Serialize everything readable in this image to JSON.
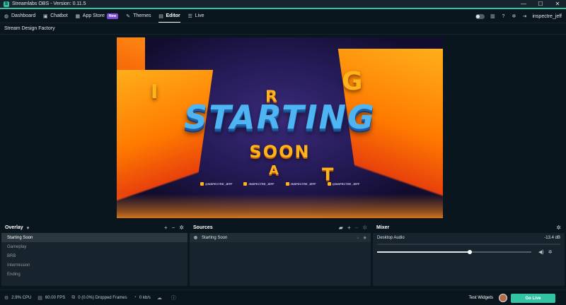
{
  "window": {
    "title": "Streamlabs OBS - Version: 0.11.5",
    "minimize": "—",
    "maximize": "☐",
    "close": "✕"
  },
  "nav": {
    "items": [
      {
        "label": "Dashboard",
        "icon": "dashboard-icon"
      },
      {
        "label": "Chatbot",
        "icon": "robot-icon"
      },
      {
        "label": "App Store",
        "icon": "store-icon",
        "badge": "New"
      },
      {
        "label": "Themes",
        "icon": "themes-icon"
      },
      {
        "label": "Editor",
        "icon": "editor-icon",
        "active": true
      },
      {
        "label": "Live",
        "icon": "live-icon"
      }
    ],
    "user": "inspectre_jeff"
  },
  "scene_title": "Stream Design Factory",
  "preview": {
    "headline": "STARTING",
    "subline": "SOON",
    "floating_letters": [
      "I",
      "G",
      "R",
      "A",
      "T"
    ],
    "socials": [
      "@INSPECTRE_JEFF",
      "/INSPECTRE_JEFF",
      "/INSPECTRE_JEFF",
      "@INSPECTRE_JEFF"
    ]
  },
  "scenes": {
    "title": "Overlay",
    "items": [
      "Starting Soon",
      "Gameplay",
      "BRB",
      "Intermission",
      "Ending"
    ],
    "selected": 0
  },
  "sources": {
    "title": "Sources",
    "items": [
      "Starting Soon"
    ]
  },
  "mixer": {
    "title": "Mixer",
    "channel": "Desktop Audio",
    "level": "-13.4 dB",
    "meter_fraction": 0.0,
    "volume_fraction": 0.6
  },
  "footer": {
    "cpu": "2.9% CPU",
    "fps": "60.00 FPS",
    "dropped": "0 (0.0%) Dropped Frames",
    "bandwidth": "0 kb/s",
    "test_widgets": "Test Widgets",
    "go_live": "Go Live"
  },
  "colors": {
    "accent": "#31c3a2",
    "badge": "#7d4cd8",
    "panel": "#17242d",
    "background": "#09161d"
  }
}
